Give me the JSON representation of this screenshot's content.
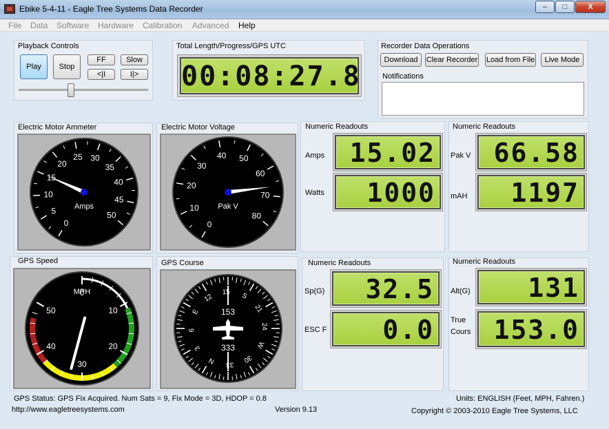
{
  "window": {
    "title": "Ebike 5-4-11 - Eagle Tree Systems Data Recorder",
    "controls": {
      "minimize": "–",
      "maximize": "□",
      "close": "X"
    }
  },
  "menu": [
    "File",
    "Data",
    "Software",
    "Hardware",
    "Calibration",
    "Advanced",
    "Help"
  ],
  "playback": {
    "title": "Playback Controls",
    "play": "Play",
    "stop": "Stop",
    "ff": "FF",
    "slow": "Slow",
    "back": "<|I",
    "forward": "I|>",
    "slider_position": 0.4
  },
  "progress": {
    "title": "Total Length/Progress/GPS UTC",
    "value": "00:08:27.84"
  },
  "recorder": {
    "title": "Recorder Data Operations",
    "download": "Download",
    "clear": "Clear Recorder",
    "load": "Load from File",
    "live": "Live Mode",
    "notifications_label": "Notifications"
  },
  "ammeter": {
    "title": "Electric Motor Ammeter",
    "unit": "Amps",
    "ticks": [
      "0",
      "5",
      "10",
      "15",
      "20",
      "25",
      "30",
      "35",
      "40",
      "45",
      "50"
    ],
    "value": 15.02
  },
  "voltmeter": {
    "title": "Electric Motor Voltage",
    "unit": "Pak V",
    "ticks": [
      "0",
      "10",
      "20",
      "30",
      "40",
      "50",
      "60",
      "70",
      "80"
    ],
    "value": 66.58
  },
  "readouts_top_left": {
    "title": "Numeric Readouts",
    "rows": [
      {
        "label": "Amps",
        "value": "15.02"
      },
      {
        "label": "Watts",
        "value": "1000"
      }
    ]
  },
  "readouts_top_right": {
    "title": "Numeric Readouts",
    "rows": [
      {
        "label": "Pak V",
        "value": "66.58"
      },
      {
        "label": "mAH",
        "value": "1197"
      }
    ]
  },
  "gps_speed": {
    "title": "GPS Speed",
    "unit": "MPH",
    "ticks": [
      "0",
      "10",
      "20",
      "30",
      "40",
      "50"
    ],
    "value": 32.5
  },
  "gps_course": {
    "title": "GPS Course",
    "heading_value": "153",
    "reciprocal_value": "333",
    "compass_labels": [
      "N",
      "3",
      "6",
      "E",
      "12",
      "15",
      "S",
      "21",
      "24",
      "W",
      "30",
      "33"
    ],
    "heading_degrees": 153
  },
  "readouts_bottom_left": {
    "title": "Numeric Readouts",
    "rows": [
      {
        "label": "Sp(G)",
        "value": "32.5"
      },
      {
        "label": "ESC F",
        "value": "0.0"
      }
    ]
  },
  "readouts_bottom_right": {
    "title": "Numeric Readouts",
    "rows": [
      {
        "label": "Alt(G)",
        "value": "131"
      },
      {
        "label": "True Cours",
        "value": "153.0"
      }
    ]
  },
  "status": {
    "gps_status": "GPS Status:  GPS Fix Acquired.  Num Sats = 9, Fix Mode = 3D, HDOP = 0.8",
    "units": "Units: ENGLISH (Feet, MPH, Fahren.)",
    "url": "http://www.eagletreesystems.com",
    "version": "Version 9.13",
    "copyright": "Copyright © 2003-2010 Eagle Tree Systems, LLC"
  },
  "colors": {
    "lcd": "#b2d655",
    "needle": "#ffffff",
    "hub": "#1010d8",
    "speed_red": "#b02020",
    "speed_yellow": "#f0f000",
    "speed_green": "#20a020"
  }
}
